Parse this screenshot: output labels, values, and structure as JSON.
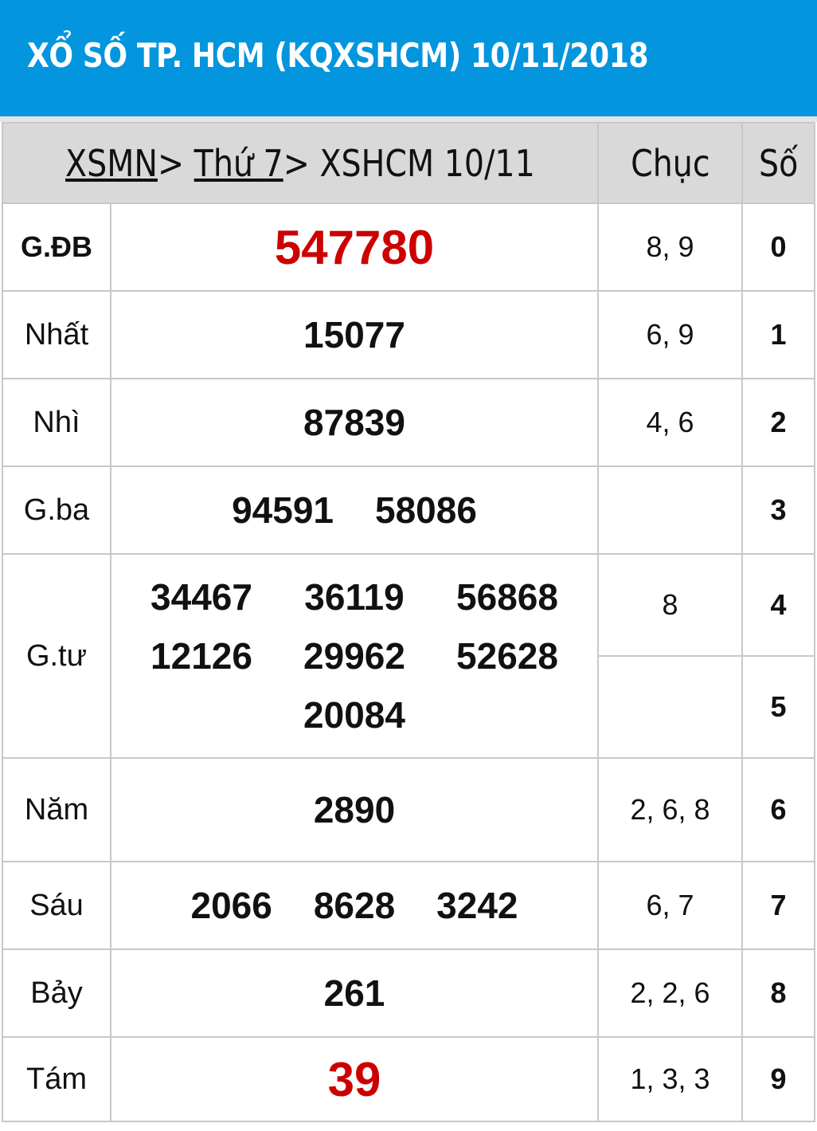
{
  "header": {
    "title": "XỔ SỐ TP. HCM (KQXSHCM) 10/11/2018"
  },
  "table_header": {
    "breadcrumb": [
      {
        "label": "XSMN",
        "link": true
      },
      {
        "label": "> ",
        "link": false
      },
      {
        "label": "Thứ 7",
        "link": true
      },
      {
        "label": "> XSHCM 10/11",
        "link": false
      }
    ],
    "chuc": "Chục",
    "so": "Số"
  },
  "prizes": [
    {
      "label": "G.ĐB",
      "numbers": [
        "547780"
      ]
    },
    {
      "label": "Nhất",
      "numbers": [
        "15077"
      ]
    },
    {
      "label": "Nhì",
      "numbers": [
        "87839"
      ]
    },
    {
      "label": "G.ba",
      "numbers": [
        "94591",
        "58086"
      ]
    },
    {
      "label": "G.tư",
      "numbers": [
        "34467",
        "36119",
        "56868",
        "12126",
        "29962",
        "52628",
        "20084"
      ]
    },
    {
      "label": "Năm",
      "numbers": [
        "2890"
      ]
    },
    {
      "label": "Sáu",
      "numbers": [
        "2066",
        "8628",
        "3242"
      ]
    },
    {
      "label": "Bảy",
      "numbers": [
        "261"
      ]
    },
    {
      "label": "Tám",
      "numbers": [
        "39"
      ]
    }
  ],
  "loto": [
    {
      "so": "0",
      "chuc": "8, 9"
    },
    {
      "so": "1",
      "chuc": "6, 9"
    },
    {
      "so": "2",
      "chuc": "4, 6"
    },
    {
      "so": "3",
      "chuc": ""
    },
    {
      "so": "4",
      "chuc": "8"
    },
    {
      "so": "5",
      "chuc": ""
    },
    {
      "so": "6",
      "chuc": "2, 6, 8"
    },
    {
      "so": "7",
      "chuc": "6, 7"
    },
    {
      "so": "8",
      "chuc": "2, 2, 6"
    },
    {
      "so": "9",
      "chuc": "1, 3, 3"
    }
  ],
  "colors": {
    "header_bg": "#0395dd",
    "highlight": "#cc0000",
    "table_head_bg": "#d9d9d9"
  }
}
